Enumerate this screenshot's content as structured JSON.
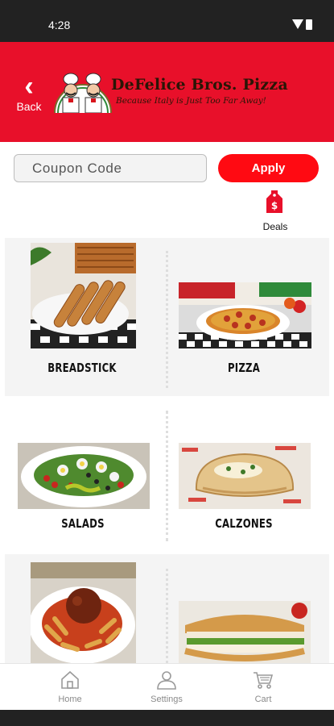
{
  "status_bar": {
    "time": "4:28"
  },
  "header": {
    "back_label": "Back",
    "logo_title": "DeFelice Bros. Pizza",
    "logo_tagline": "Because Italy is Just Too Far Away!",
    "background": "#e8102a"
  },
  "coupon": {
    "placeholder": "Coupon Code",
    "value": "",
    "apply_label": "Apply"
  },
  "deals": {
    "label": "Deals"
  },
  "menu": {
    "items": [
      {
        "label": "BREADSTICK"
      },
      {
        "label": "PIZZA"
      },
      {
        "label": "SALADS"
      },
      {
        "label": "CALZONES"
      },
      {
        "label": ""
      },
      {
        "label": ""
      }
    ]
  },
  "bottom_nav": [
    {
      "label": "Home",
      "icon": "home-icon"
    },
    {
      "label": "Settings",
      "icon": "person-icon"
    },
    {
      "label": "Cart",
      "icon": "cart-icon"
    }
  ],
  "colors": {
    "brand_red": "#e8102a",
    "apply_red": "#ff0a12",
    "nav_gray": "#8a8a8a"
  }
}
